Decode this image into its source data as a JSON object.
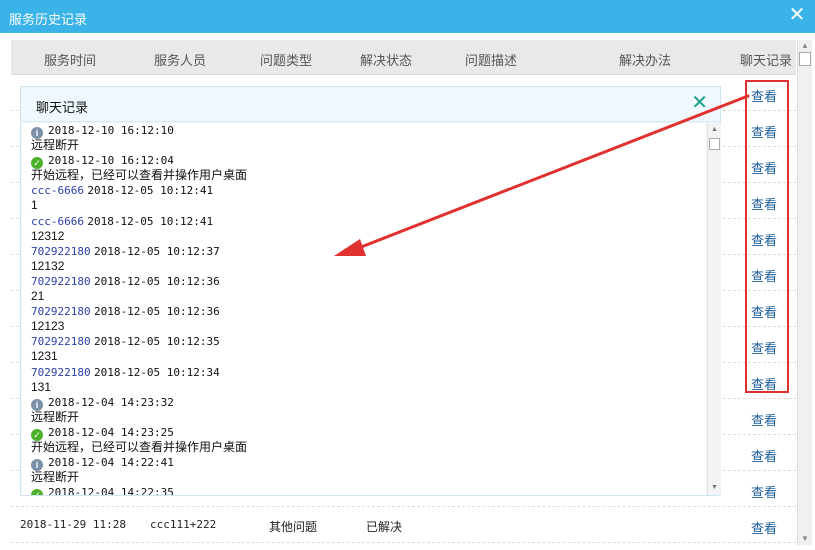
{
  "window": {
    "title": "服务历史记录",
    "close_icon": "close-icon"
  },
  "table": {
    "headers": [
      "服务时间",
      "服务人员",
      "问题类型",
      "解决状态",
      "问题描述",
      "解决办法",
      "聊天记录"
    ],
    "view_label": "查看",
    "view_count": 13,
    "last_row": {
      "time": "2018-11-29 11:28",
      "staff": "ccc111+222",
      "type": "其他问题",
      "status": "已解决"
    }
  },
  "chat_popup": {
    "title": "聊天记录",
    "lines": [
      {
        "icon": "info",
        "user": "",
        "time": "2018-12-10 16:12:10"
      },
      {
        "text": "远程断开"
      },
      {
        "icon": "ok",
        "user": "",
        "time": "2018-12-10 16:12:04"
      },
      {
        "text": "开始远程，已经可以查看并操作用户桌面"
      },
      {
        "user": "ccc-6666",
        "time": "2018-12-05 10:12:41"
      },
      {
        "text": "1"
      },
      {
        "user": "ccc-6666",
        "time": "2018-12-05 10:12:41"
      },
      {
        "text": "12312"
      },
      {
        "user": "702922180",
        "time": "2018-12-05 10:12:37"
      },
      {
        "text": "12132"
      },
      {
        "user": "702922180",
        "time": "2018-12-05 10:12:36"
      },
      {
        "text": "21"
      },
      {
        "user": "702922180",
        "time": "2018-12-05 10:12:36"
      },
      {
        "text": "12123"
      },
      {
        "user": "702922180",
        "time": "2018-12-05 10:12:35"
      },
      {
        "text": "1231"
      },
      {
        "user": "702922180",
        "time": "2018-12-05 10:12:34"
      },
      {
        "text": "131"
      },
      {
        "icon": "info",
        "user": "",
        "time": "2018-12-04 14:23:32"
      },
      {
        "text": "远程断开"
      },
      {
        "icon": "ok",
        "user": "",
        "time": "2018-12-04 14:23:25"
      },
      {
        "text": "开始远程，已经可以查看并操作用户桌面"
      },
      {
        "icon": "info",
        "user": "",
        "time": "2018-12-04 14:22:41"
      },
      {
        "text": "远程断开"
      },
      {
        "icon": "ok",
        "user": "",
        "time": "2018-12-04 14:22:35"
      }
    ]
  },
  "colors": {
    "titlebar": "#3ab4e8",
    "link": "#1a5f9c",
    "annotation": "#e0312e"
  }
}
